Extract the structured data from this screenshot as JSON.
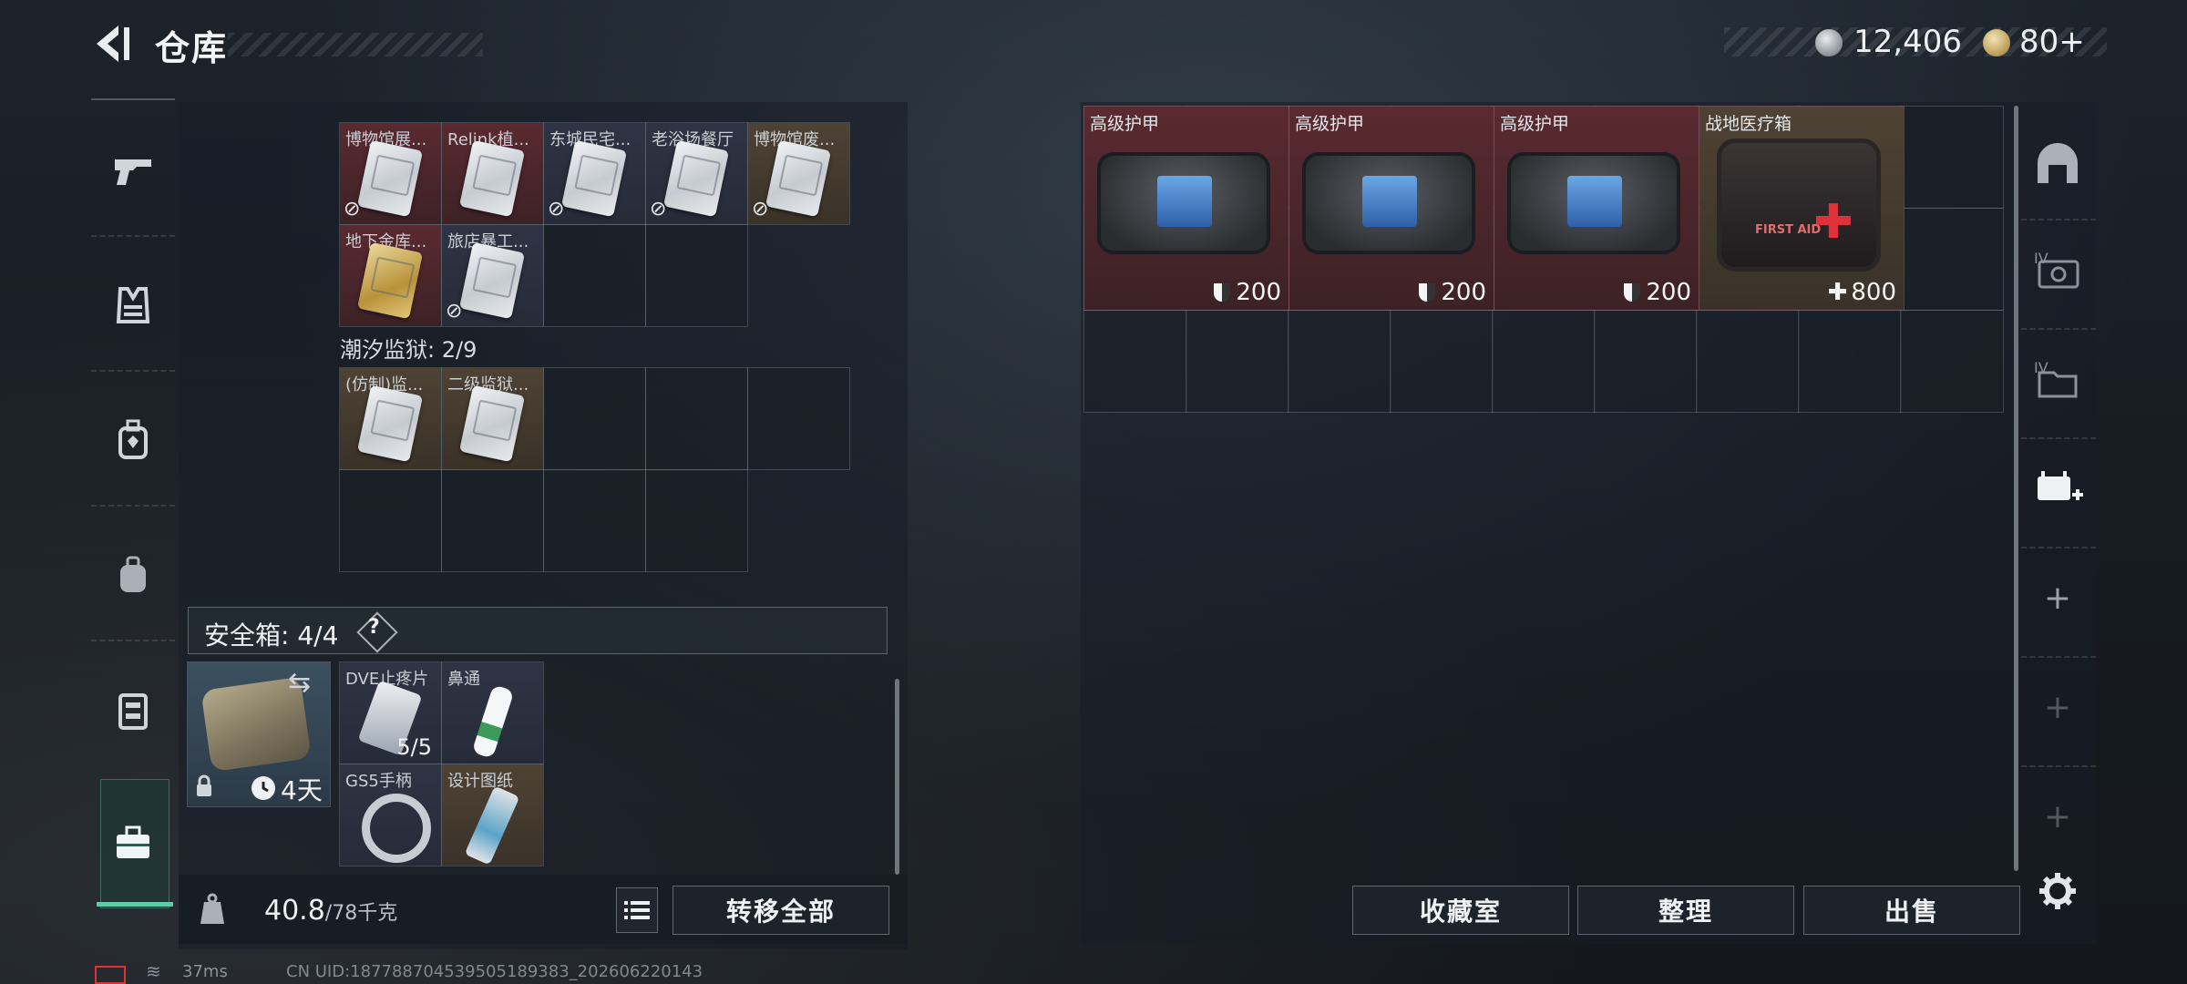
{
  "header": {
    "title": "仓库",
    "currency1": "12,406",
    "currency2": "80+",
    "version": "",
    "currency1_icon": "silver-coin-icon",
    "currency2_icon": "gold-coin-icon"
  },
  "left_nav": [
    {
      "name": "weapon",
      "icon": "pistol-icon"
    },
    {
      "name": "armor",
      "icon": "vest-icon"
    },
    {
      "name": "helmet-bag",
      "icon": "backpack-icon"
    },
    {
      "name": "backpack",
      "icon": "bag-icon"
    },
    {
      "name": "rig",
      "icon": "chest-rig-icon"
    },
    {
      "name": "safe-case",
      "icon": "briefcase-icon",
      "active": true
    }
  ],
  "keys_section": {
    "rows": [
      [
        {
          "label": "博物馆展...",
          "tone": "red",
          "no_link": true
        },
        {
          "label": "Relink植...",
          "tone": "red",
          "no_link": false
        },
        {
          "label": "东城民宅...",
          "tone": "blue",
          "no_link": true
        },
        {
          "label": "老浴场餐厅",
          "tone": "blue",
          "no_link": true
        },
        {
          "label": "博物馆废...",
          "tone": "gold",
          "no_link": true
        }
      ],
      [
        {
          "label": "地下金库...",
          "tone": "red",
          "no_link": false,
          "gold": true
        },
        {
          "label": "旅店暴工...",
          "tone": "blue",
          "no_link": true
        }
      ]
    ]
  },
  "prison_section": {
    "title": "潮汐监狱: 2/9",
    "items": [
      {
        "label": "(仿制)监...",
        "tone": "gold"
      },
      {
        "label": "二级监狱...",
        "tone": "gold"
      }
    ]
  },
  "safe_box": {
    "label": "安全箱: 4/4",
    "help": "?",
    "time_left": "4天",
    "items": [
      {
        "label": "DVE止疼片",
        "count": "5/5",
        "tone": "blue"
      },
      {
        "label": "鼻通",
        "count": "",
        "tone": "blue"
      },
      {
        "label": "GS5手柄",
        "count": "",
        "tone": "blue"
      },
      {
        "label": "设计图纸",
        "count": "",
        "tone": "gold"
      }
    ]
  },
  "bottom_bar": {
    "weight_current": "40.8",
    "weight_max": "/78千克",
    "transfer_all": "转移全部"
  },
  "stash_items": [
    {
      "label": "高级护甲",
      "value": "200",
      "icon": "shield-icon"
    },
    {
      "label": "高级护甲",
      "value": "200",
      "icon": "shield-icon"
    },
    {
      "label": "高级护甲",
      "value": "200",
      "icon": "shield-icon"
    },
    {
      "label": "战地医疗箱",
      "value": "800",
      "icon": "plus-icon",
      "art": "FIRST AID"
    }
  ],
  "right_buttons": {
    "collection": "收藏室",
    "organize": "整理",
    "sell": "出售"
  },
  "right_nav": [
    {
      "name": "stash-tab-1",
      "icon": "arch-icon"
    },
    {
      "name": "stash-tab-2",
      "icon": "iv-case-icon"
    },
    {
      "name": "stash-tab-3",
      "icon": "iv-folder-icon"
    },
    {
      "name": "stash-tab-4",
      "icon": "medkit-plus-icon",
      "active": true
    },
    {
      "name": "add-tab-1",
      "icon": "add-icon"
    },
    {
      "name": "add-tab-2",
      "icon": "add-icon"
    },
    {
      "name": "add-tab-3",
      "icon": "add-icon"
    }
  ],
  "footer": {
    "ping": "37ms",
    "uid": "CN UID:18778870453950518938​3_202606220143"
  }
}
